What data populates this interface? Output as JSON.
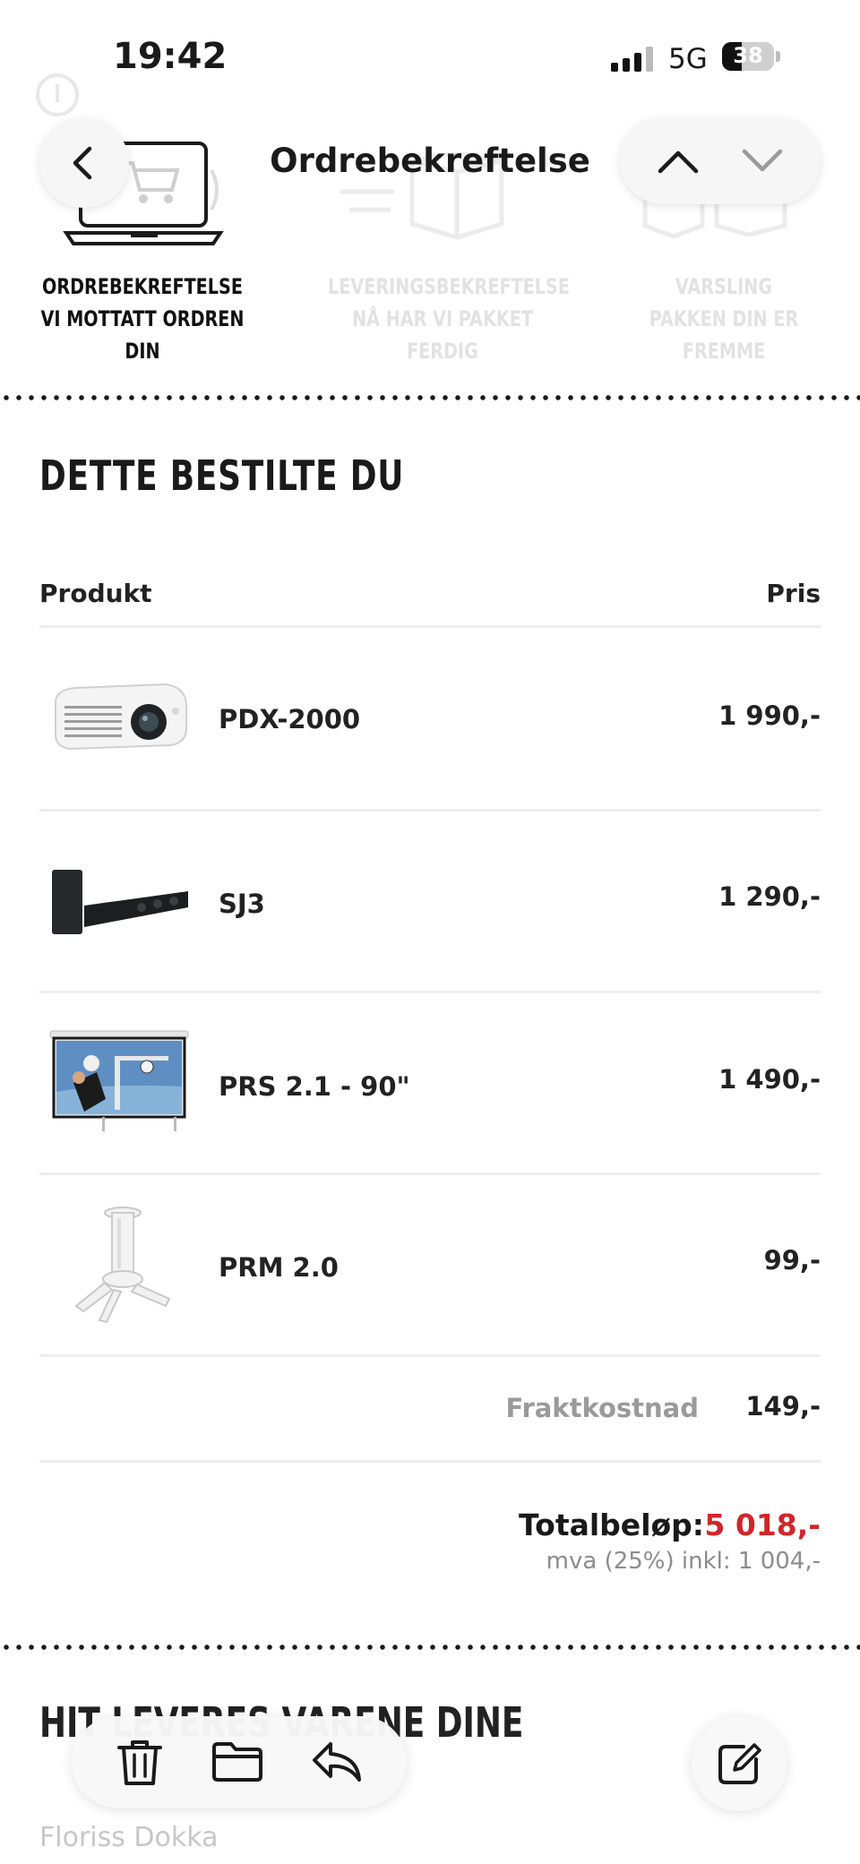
{
  "status_bar": {
    "time": "19:42",
    "network": "5G",
    "battery": "38",
    "battery_level": 0.38
  },
  "nav": {
    "title": "Ordrebekreftelse"
  },
  "steps": [
    {
      "title": "ORDREBEKREFTELSE",
      "subtitle": "VI MOTTATT ORDREN DIN",
      "active": true
    },
    {
      "title": "LEVERINGSBEKREFTELSE",
      "subtitle": "NÅ HAR VI PAKKET FERDIG",
      "active": false
    },
    {
      "title": "VARSLING",
      "subtitle": "PAKKEN DIN ER FREMME",
      "active": false
    }
  ],
  "order": {
    "heading": "DETTE BESTILTE DU",
    "col_product": "Produkt",
    "col_price": "Pris",
    "items": [
      {
        "name": "PDX-2000",
        "price": "1 990,-",
        "icon": "projector-icon"
      },
      {
        "name": "SJ3",
        "price": "1 290,-",
        "icon": "soundbar-icon"
      },
      {
        "name": "PRS 2.1 - 90\"",
        "price": "1 490,-",
        "icon": "projector-screen-icon"
      },
      {
        "name": "PRM 2.0",
        "price": "99,-",
        "icon": "ceiling-mount-icon"
      }
    ],
    "shipping_label": "Fraktkostnad",
    "shipping_value": "149,-",
    "total_label": "Totalbeløp:",
    "total_value": "5 018,-",
    "vat_text": "mva (25%) inkl: 1 004,-"
  },
  "delivery": {
    "heading": "HIT LEVERES VARENE DINE",
    "recipient": "Floriss Dokka"
  },
  "colors": {
    "accent_red": "#d0262b",
    "text": "#1a1a1a",
    "muted": "#9a9a9a"
  }
}
